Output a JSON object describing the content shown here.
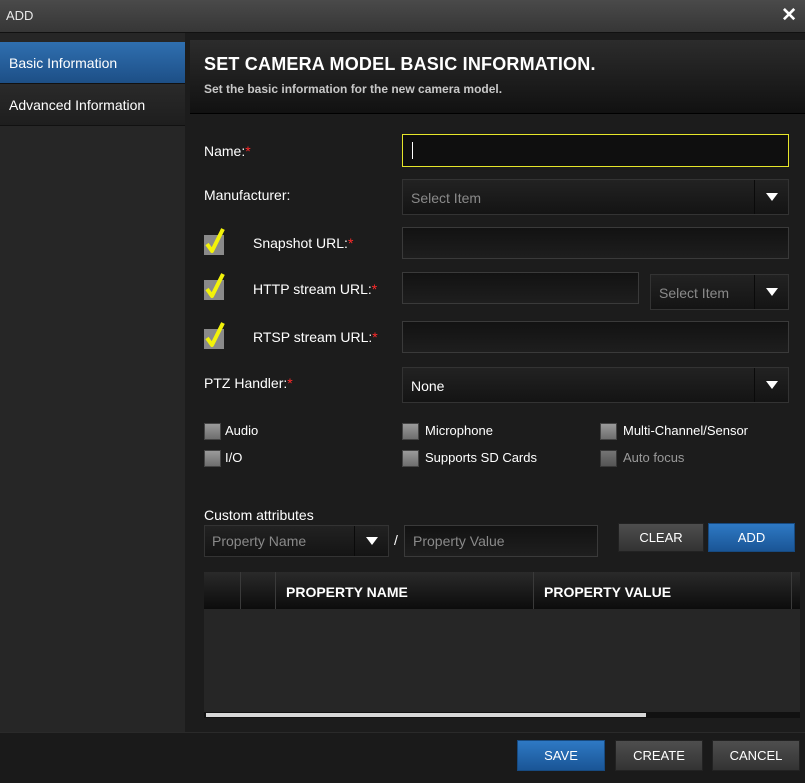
{
  "window": {
    "title": "ADD"
  },
  "sidebar": {
    "items": [
      {
        "label": "Basic Information"
      },
      {
        "label": "Advanced Information"
      }
    ]
  },
  "header": {
    "title": "SET CAMERA MODEL BASIC INFORMATION.",
    "subtitle": "Set the basic information for the new camera model."
  },
  "form": {
    "name_label": "Name:",
    "manufacturer_label": "Manufacturer:",
    "manufacturer_placeholder": "Select Item",
    "snapshot_label": "Snapshot URL:",
    "http_label": "HTTP stream URL:",
    "http_select_placeholder": "Select Item",
    "rtsp_label": "RTSP stream URL:",
    "ptz_label": "PTZ Handler:",
    "ptz_value": "None",
    "required_mark": "*"
  },
  "features": [
    {
      "label": "Audio",
      "enabled": true
    },
    {
      "label": "Microphone",
      "enabled": true
    },
    {
      "label": "Multi-Channel/Sensor",
      "enabled": true
    },
    {
      "label": "I/O",
      "enabled": true
    },
    {
      "label": "Supports SD Cards",
      "enabled": true
    },
    {
      "label": "Auto focus",
      "enabled": false
    }
  ],
  "custom": {
    "label": "Custom attributes",
    "name_placeholder": "Property Name",
    "separator": "/",
    "value_placeholder": "Property Value",
    "clear_label": "CLEAR",
    "add_label": "ADD"
  },
  "table": {
    "columns": [
      "PROPERTY NAME",
      "PROPERTY VALUE"
    ],
    "rows": []
  },
  "footer": {
    "save_label": "SAVE",
    "create_label": "CREATE",
    "cancel_label": "CANCEL"
  },
  "colors": {
    "accent_blue": "#1f5fa0",
    "focus_yellow": "#e6e62a",
    "required_red": "#ff2a2a",
    "check_yellow": "#f2f20a"
  }
}
